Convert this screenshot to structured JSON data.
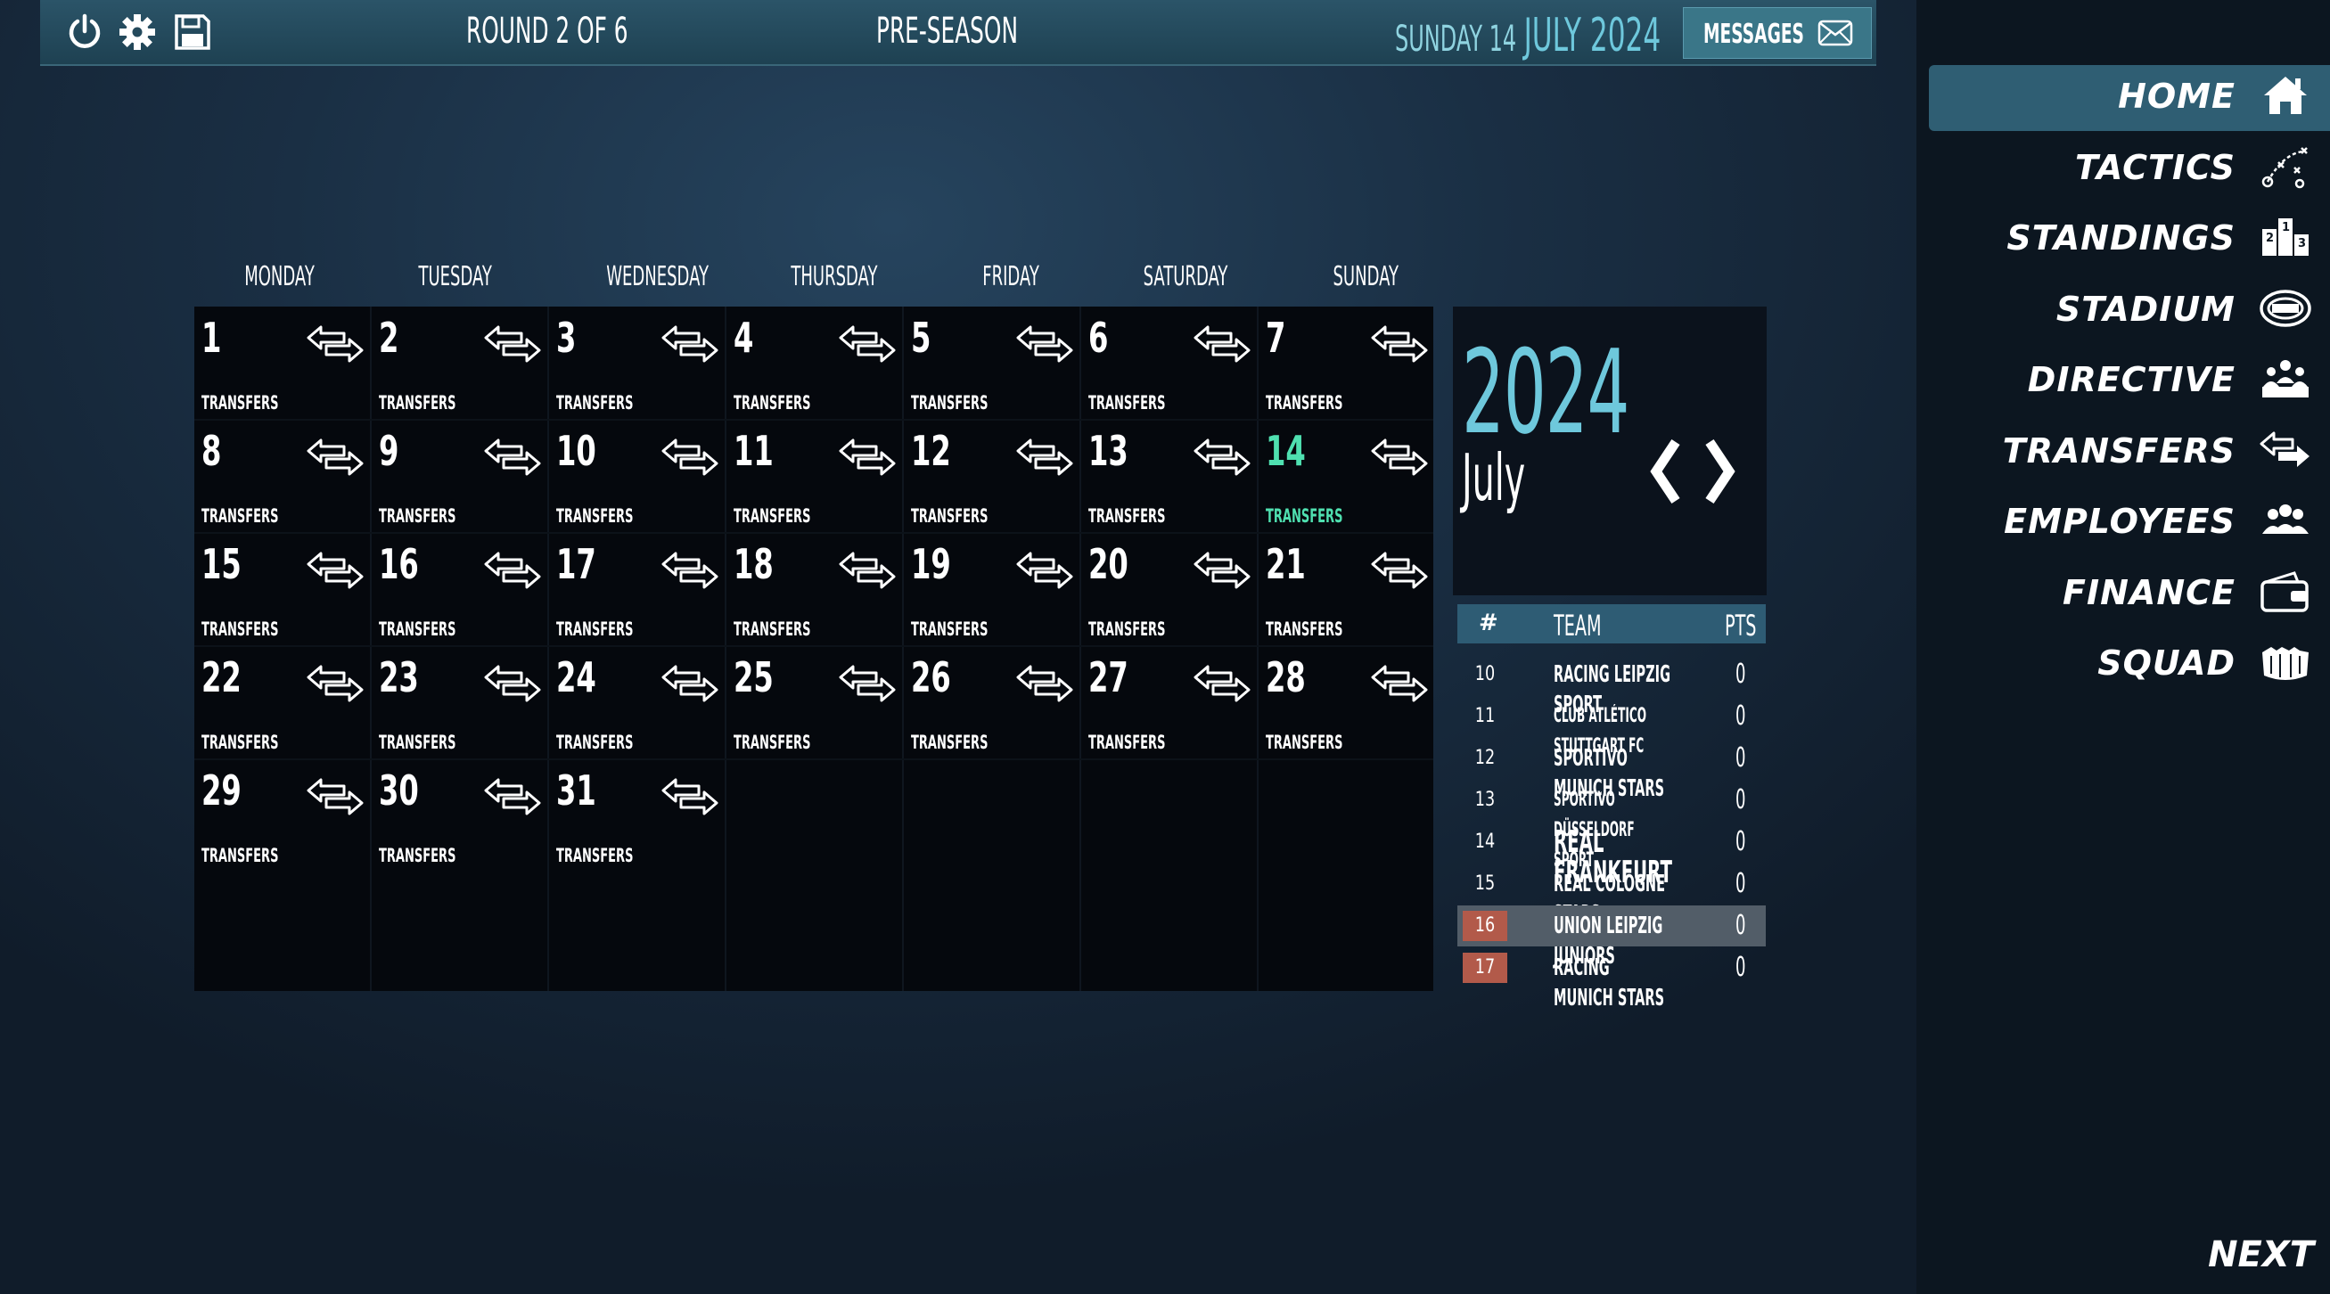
{
  "topbar": {
    "round": "ROUND 2 OF 6",
    "season_phase": "PRE-SEASON",
    "date_day": "SUNDAY 14",
    "date_month": "JULY 2024",
    "messages_label": "MESSAGES"
  },
  "calendar": {
    "weekdays": [
      "MONDAY",
      "TUESDAY",
      "WEDNESDAY",
      "THURSDAY",
      "FRIDAY",
      "SATURDAY",
      "SUNDAY"
    ],
    "days": [
      {
        "day": "1",
        "label": "TRANSFERS"
      },
      {
        "day": "2",
        "label": "TRANSFERS"
      },
      {
        "day": "3",
        "label": "TRANSFERS"
      },
      {
        "day": "4",
        "label": "TRANSFERS"
      },
      {
        "day": "5",
        "label": "TRANSFERS"
      },
      {
        "day": "6",
        "label": "TRANSFERS"
      },
      {
        "day": "7",
        "label": "TRANSFERS"
      },
      {
        "day": "8",
        "label": "TRANSFERS"
      },
      {
        "day": "9",
        "label": "TRANSFERS"
      },
      {
        "day": "10",
        "label": "TRANSFERS"
      },
      {
        "day": "11",
        "label": "TRANSFERS"
      },
      {
        "day": "12",
        "label": "TRANSFERS"
      },
      {
        "day": "13",
        "label": "TRANSFERS"
      },
      {
        "day": "14",
        "label": "TRANSFERS",
        "today": true
      },
      {
        "day": "15",
        "label": "TRANSFERS"
      },
      {
        "day": "16",
        "label": "TRANSFERS"
      },
      {
        "day": "17",
        "label": "TRANSFERS"
      },
      {
        "day": "18",
        "label": "TRANSFERS"
      },
      {
        "day": "19",
        "label": "TRANSFERS"
      },
      {
        "day": "20",
        "label": "TRANSFERS"
      },
      {
        "day": "21",
        "label": "TRANSFERS"
      },
      {
        "day": "22",
        "label": "TRANSFERS"
      },
      {
        "day": "23",
        "label": "TRANSFERS"
      },
      {
        "day": "24",
        "label": "TRANSFERS"
      },
      {
        "day": "25",
        "label": "TRANSFERS"
      },
      {
        "day": "26",
        "label": "TRANSFERS"
      },
      {
        "day": "27",
        "label": "TRANSFERS"
      },
      {
        "day": "28",
        "label": "TRANSFERS"
      },
      {
        "day": "29",
        "label": "TRANSFERS"
      },
      {
        "day": "30",
        "label": "TRANSFERS"
      },
      {
        "day": "31",
        "label": "TRANSFERS"
      }
    ],
    "today_color": "#4fe0b0"
  },
  "year_panel": {
    "year": "2024",
    "month": "July"
  },
  "standings": {
    "headers": {
      "pos": "#",
      "team": "TEAM",
      "pts": "PTS"
    },
    "rows": [
      {
        "pos": "10",
        "team": "RACING LEIPZIG SPORT",
        "pts": "0",
        "size": "mid"
      },
      {
        "pos": "11",
        "team": "CLUB ATLÉTICO STUTTGART FC",
        "pts": "0",
        "size": "small"
      },
      {
        "pos": "12",
        "team": "SPORTIVO MUNICH STARS",
        "pts": "0",
        "size": "mid"
      },
      {
        "pos": "13",
        "team": "SPORTIVO DÜSSELDORF SPORT",
        "pts": "0",
        "size": "small"
      },
      {
        "pos": "14",
        "team": "REAL FRANKFURT",
        "pts": "0",
        "size": "large"
      },
      {
        "pos": "15",
        "team": "REAL COLOGNE STARS",
        "pts": "0",
        "size": "mid"
      },
      {
        "pos": "16",
        "team": "UNION LEIPZIG JUNIORS",
        "pts": "0",
        "size": "mid",
        "highlight": true,
        "relegation": true
      },
      {
        "pos": "17",
        "team": "RACING MUNICH STARS",
        "pts": "0",
        "size": "mid",
        "relegation": true
      }
    ],
    "relegation_color": "#b25a4a"
  },
  "menu": {
    "items": [
      {
        "label": "HOME",
        "icon": "home-icon",
        "active": true
      },
      {
        "label": "TACTICS",
        "icon": "tactics-icon"
      },
      {
        "label": "STANDINGS",
        "icon": "podium-icon"
      },
      {
        "label": "STADIUM",
        "icon": "stadium-icon"
      },
      {
        "label": "DIRECTIVE",
        "icon": "board-members-icon"
      },
      {
        "label": "TRANSFERS",
        "icon": "transfer-arrows-icon"
      },
      {
        "label": "EMPLOYEES",
        "icon": "employees-icon"
      },
      {
        "label": "FINANCE",
        "icon": "wallet-icon"
      },
      {
        "label": "SQUAD",
        "icon": "squad-icon"
      }
    ],
    "next_label": "NEXT"
  }
}
